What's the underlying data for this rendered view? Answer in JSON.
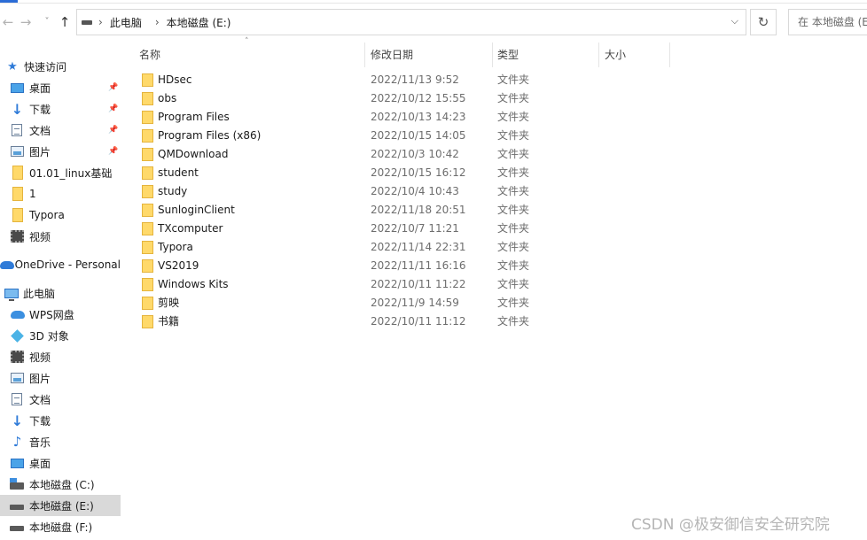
{
  "address_bar": {
    "crumbs": [
      "此电脑",
      "本地磁盘 (E:)"
    ],
    "search_placeholder": "在 本地磁盘 (E:)"
  },
  "columns": {
    "name": "名称",
    "date": "修改日期",
    "type": "类型",
    "size": "大小"
  },
  "nav": {
    "quick_access": "快速访问",
    "pinned": [
      {
        "label": "桌面",
        "icon": "desktop-icon"
      },
      {
        "label": "下载",
        "icon": "download-icon"
      },
      {
        "label": "文档",
        "icon": "document-icon"
      },
      {
        "label": "图片",
        "icon": "picture-icon"
      }
    ],
    "recent": [
      {
        "label": "01.01_linux基础",
        "icon": "folder-icon"
      },
      {
        "label": "1",
        "icon": "folder-icon"
      },
      {
        "label": "Typora",
        "icon": "folder-icon"
      },
      {
        "label": "视频",
        "icon": "video-icon"
      }
    ],
    "onedrive": "OneDrive - Personal",
    "this_pc": "此电脑",
    "pc_items": [
      {
        "label": "WPS网盘",
        "icon": "wps-cloud-icon"
      },
      {
        "label": "3D 对象",
        "icon": "3d-objects-icon"
      },
      {
        "label": "视频",
        "icon": "video-icon"
      },
      {
        "label": "图片",
        "icon": "picture-icon"
      },
      {
        "label": "文档",
        "icon": "document-icon"
      },
      {
        "label": "下载",
        "icon": "download-icon"
      },
      {
        "label": "音乐",
        "icon": "music-icon"
      },
      {
        "label": "桌面",
        "icon": "desktop-icon"
      },
      {
        "label": "本地磁盘 (C:)",
        "icon": "drive-c-icon"
      },
      {
        "label": "本地磁盘 (E:)",
        "icon": "drive-icon",
        "selected": true
      },
      {
        "label": "本地磁盘 (F:)",
        "icon": "drive-icon"
      }
    ]
  },
  "files": [
    {
      "name": "HDsec",
      "date": "2022/11/13 9:52",
      "type": "文件夹"
    },
    {
      "name": "obs",
      "date": "2022/10/12 15:55",
      "type": "文件夹"
    },
    {
      "name": "Program Files",
      "date": "2022/10/13 14:23",
      "type": "文件夹"
    },
    {
      "name": "Program Files (x86)",
      "date": "2022/10/15 14:05",
      "type": "文件夹"
    },
    {
      "name": "QMDownload",
      "date": "2022/10/3 10:42",
      "type": "文件夹"
    },
    {
      "name": "student",
      "date": "2022/10/15 16:12",
      "type": "文件夹"
    },
    {
      "name": "study",
      "date": "2022/10/4 10:43",
      "type": "文件夹"
    },
    {
      "name": "SunloginClient",
      "date": "2022/11/18 20:51",
      "type": "文件夹"
    },
    {
      "name": "TXcomputer",
      "date": "2022/10/7 11:21",
      "type": "文件夹"
    },
    {
      "name": "Typora",
      "date": "2022/11/14 22:31",
      "type": "文件夹"
    },
    {
      "name": "VS2019",
      "date": "2022/11/11 16:16",
      "type": "文件夹"
    },
    {
      "name": "Windows Kits",
      "date": "2022/10/11 11:22",
      "type": "文件夹"
    },
    {
      "name": "剪映",
      "date": "2022/11/9 14:59",
      "type": "文件夹"
    },
    {
      "name": "书籍",
      "date": "2022/10/11 11:12",
      "type": "文件夹"
    }
  ],
  "watermark": "CSDN @极安御信安全研究院"
}
